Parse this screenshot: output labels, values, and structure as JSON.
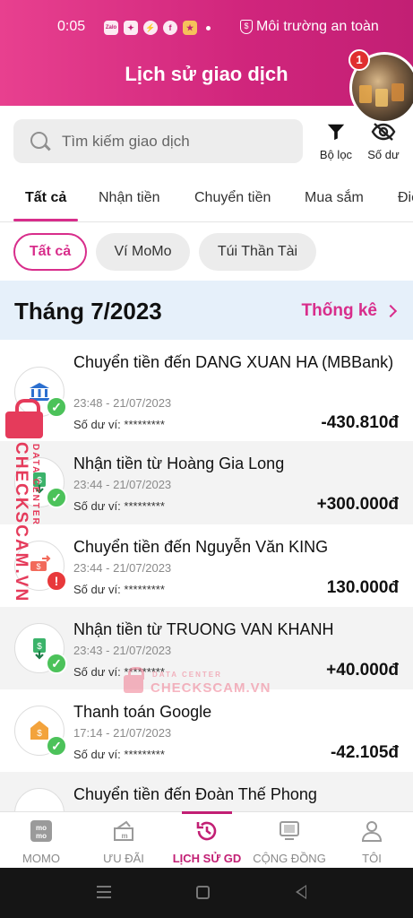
{
  "status_bar": {
    "time": "0:05",
    "app_icons": [
      "zalo-icon",
      "game-controller-icon",
      "messenger-icon",
      "facebook-icon",
      "app-icon"
    ],
    "zalo_label": "Zalo",
    "safety_label": "Môi trường an toàn"
  },
  "header": {
    "title": "Lịch sử giao dịch",
    "notification_count": "1"
  },
  "search": {
    "placeholder": "Tìm kiếm giao dịch"
  },
  "tools": {
    "filter_label": "Bộ lọc",
    "balance_label": "Số dư"
  },
  "tabs": [
    {
      "label": "Tất cả",
      "active": true
    },
    {
      "label": "Nhận tiền"
    },
    {
      "label": "Chuyển tiền"
    },
    {
      "label": "Mua sắm"
    },
    {
      "label": "Điện"
    }
  ],
  "chips": [
    {
      "label": "Tất cả",
      "active": true
    },
    {
      "label": "Ví MoMo"
    },
    {
      "label": "Túi Thần Tài"
    }
  ],
  "month": {
    "title": "Tháng 7/2023",
    "stats_label": "Thống kê"
  },
  "transactions": [
    {
      "title": "Chuyển tiền đến DANG XUAN HA (MBBank)",
      "time": "23:48 - 21/07/2023",
      "balance": "Số dư ví: *********",
      "amount": "-430.810đ",
      "status": "success",
      "icon": "bank-icon"
    },
    {
      "title": "Nhận tiền từ Hoàng Gia Long",
      "time": "23:44 - 21/07/2023",
      "balance": "Số dư ví: *********",
      "amount": "+300.000đ",
      "status": "success",
      "icon": "money-receive-icon"
    },
    {
      "title": "Chuyển tiền đến Nguyễn Văn KING",
      "time": "23:44 - 21/07/2023",
      "balance": "Số dư ví: *********",
      "amount": "130.000đ",
      "status": "failed",
      "icon": "money-transfer-icon"
    },
    {
      "title": "Nhận tiền từ TRUONG VAN KHANH",
      "time": "23:43 - 21/07/2023",
      "balance": "Số dư ví: *********",
      "amount": "+40.000đ",
      "status": "success",
      "icon": "money-receive-icon"
    },
    {
      "title": "Thanh toán Google",
      "time": "17:14 - 21/07/2023",
      "balance": "Số dư ví: *********",
      "amount": "-42.105đ",
      "status": "success",
      "icon": "payment-tag-icon"
    },
    {
      "title": "Chuyển tiền đến Đoàn Thế Phong",
      "status": "pending",
      "icon": "money-transfer-icon"
    }
  ],
  "watermark": {
    "main": "CHECKSCAM.VN",
    "sub": "DATA CENTER"
  },
  "bottom_nav": [
    {
      "label": "MOMO",
      "icon": "momo-logo-icon"
    },
    {
      "label": "ƯU ĐÃI",
      "icon": "gift-tag-icon"
    },
    {
      "label": "LỊCH SỬ GD",
      "icon": "history-clock-icon",
      "active": true
    },
    {
      "label": "CỘNG ĐỒNG",
      "icon": "community-icon"
    },
    {
      "label": "TÔI",
      "icon": "person-icon"
    }
  ],
  "colors": {
    "brand": "#d82d8b",
    "success": "#4cc25a",
    "error": "#e8393b",
    "month_bg": "#e6f0fa"
  }
}
